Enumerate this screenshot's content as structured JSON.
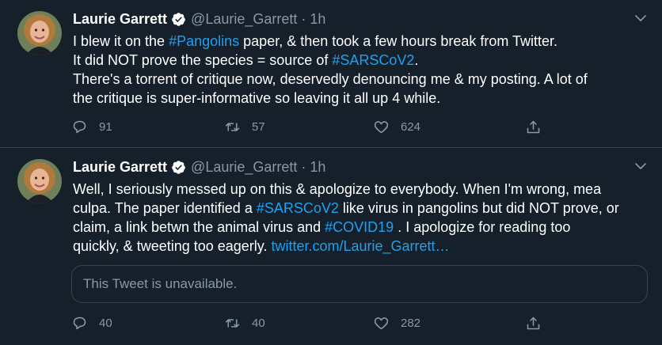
{
  "tweets": [
    {
      "name": "Laurie Garrett",
      "handle": "@Laurie_Garrett",
      "sep": "·",
      "time": "1h",
      "lines": [
        [
          {
            "t": "I blew it on the "
          },
          {
            "t": "#Pangolins",
            "h": true
          },
          {
            "t": " paper, & then took a few hours break from Twitter."
          }
        ],
        [
          {
            "t": "It did NOT prove the species = source of "
          },
          {
            "t": "#SARSCoV2",
            "h": true
          },
          {
            "t": "."
          }
        ],
        [
          {
            "t": "There's a torrent of critique now, deservedly denouncing me & my posting. A lot of"
          }
        ],
        [
          {
            "t": "the critique is super-informative so leaving it all up 4 while."
          }
        ]
      ],
      "replies": "91",
      "retweets": "57",
      "likes": "624"
    },
    {
      "name": "Laurie Garrett",
      "handle": "@Laurie_Garrett",
      "sep": "·",
      "time": "1h",
      "lines": [
        [
          {
            "t": "Well, I seriously messed up on this & apologize to everybody. When I'm wrong, mea"
          }
        ],
        [
          {
            "t": "culpa. The paper identified a "
          },
          {
            "t": "#SARSCoV2",
            "h": true
          },
          {
            "t": " like virus in pangolins but did NOT prove, or"
          }
        ],
        [
          {
            "t": "claim, a link betwn the animal virus and "
          },
          {
            "t": "#COVID19",
            "h": true
          },
          {
            "t": " . I apologize for reading too"
          }
        ],
        [
          {
            "t": "quickly, & tweeting too eagerly. "
          },
          {
            "t": "twitter.com/Laurie_Garrett…",
            "h": true
          }
        ]
      ],
      "quote_text": "This Tweet is unavailable.",
      "replies": "40",
      "retweets": "40",
      "likes": "282"
    }
  ],
  "icons": [
    "verified-badge-icon",
    "chevron-down-icon",
    "reply-icon",
    "retweet-icon",
    "like-icon",
    "share-icon"
  ],
  "colors": {
    "background": "#15202b",
    "accent": "#1da1f2",
    "muted": "#8899a6",
    "border": "#38444d"
  }
}
